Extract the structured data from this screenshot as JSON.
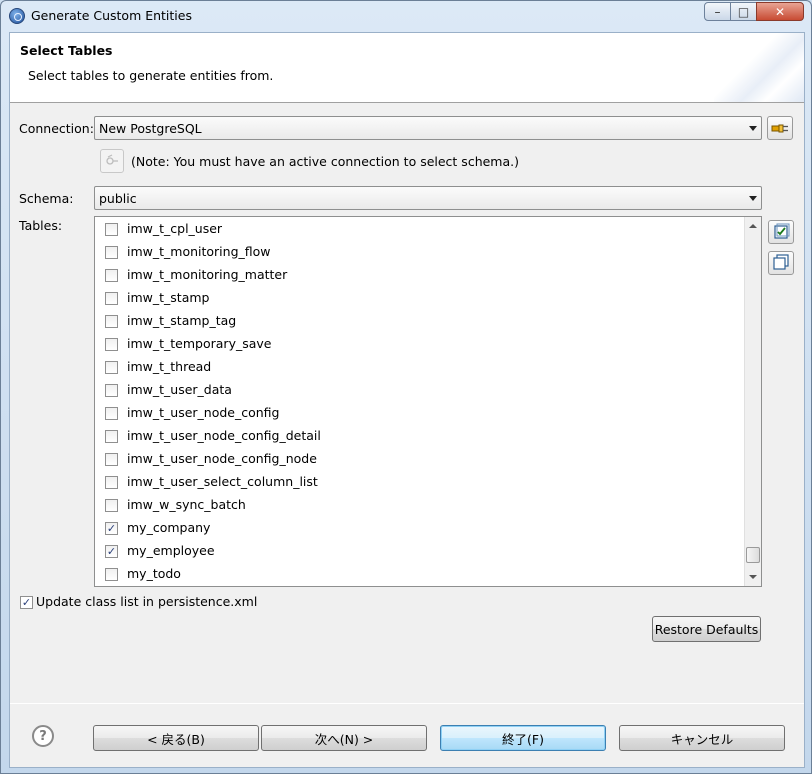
{
  "window": {
    "title": "Generate Custom Entities",
    "minimize": "–",
    "maximize": "□",
    "close": "✕"
  },
  "header": {
    "title": "Select Tables",
    "description": "Select tables to generate entities from."
  },
  "connection": {
    "label": "Connection:",
    "value": "New PostgreSQL",
    "note": "(Note: You must have an active connection to select schema.)"
  },
  "schema": {
    "label": "Schema:",
    "value": "public"
  },
  "tables": {
    "label": "Tables:",
    "items": [
      {
        "name": "imw_t_cpl_user",
        "checked": false
      },
      {
        "name": "imw_t_monitoring_flow",
        "checked": false
      },
      {
        "name": "imw_t_monitoring_matter",
        "checked": false
      },
      {
        "name": "imw_t_stamp",
        "checked": false
      },
      {
        "name": "imw_t_stamp_tag",
        "checked": false
      },
      {
        "name": "imw_t_temporary_save",
        "checked": false
      },
      {
        "name": "imw_t_thread",
        "checked": false
      },
      {
        "name": "imw_t_user_data",
        "checked": false
      },
      {
        "name": "imw_t_user_node_config",
        "checked": false
      },
      {
        "name": "imw_t_user_node_config_detail",
        "checked": false
      },
      {
        "name": "imw_t_user_node_config_node",
        "checked": false
      },
      {
        "name": "imw_t_user_select_column_list",
        "checked": false
      },
      {
        "name": "imw_w_sync_batch",
        "checked": false
      },
      {
        "name": "my_company",
        "checked": true
      },
      {
        "name": "my_employee",
        "checked": true
      },
      {
        "name": "my_todo",
        "checked": false
      }
    ]
  },
  "update_class_list": {
    "label": "Update class list in persistence.xml",
    "checked": true
  },
  "buttons": {
    "restore_defaults": "Restore Defaults",
    "back": "< 戻る(B)",
    "next": "次へ(N) >",
    "finish": "終了(F)",
    "cancel": "キャンセル",
    "help": "?"
  },
  "check_mark": "✓"
}
